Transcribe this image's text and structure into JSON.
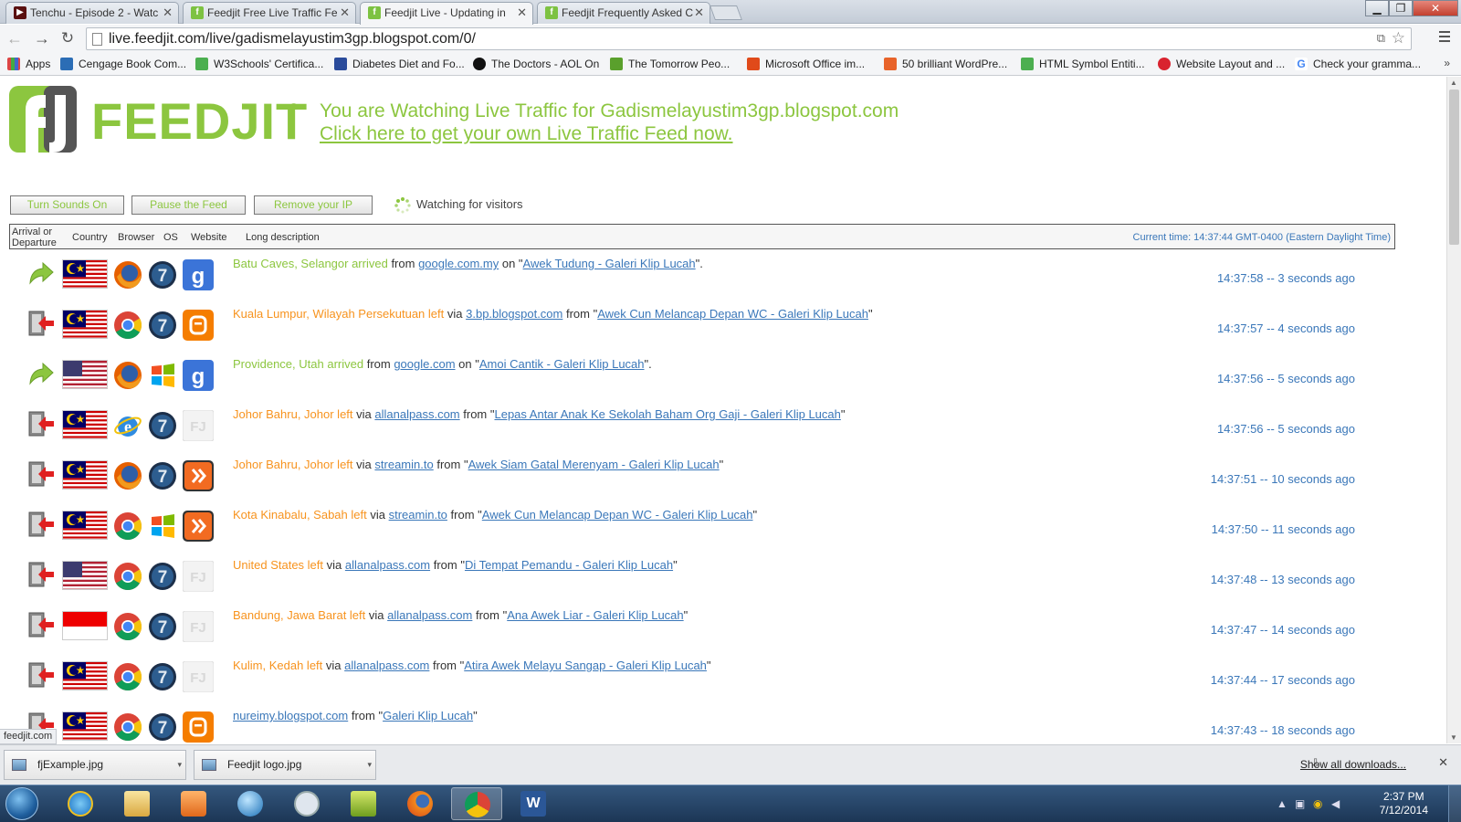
{
  "browser": {
    "tabs": [
      {
        "title": "Tenchu - Episode 2 - Watc",
        "active": false
      },
      {
        "title": "Feedjit Free Live Traffic Fe",
        "active": false
      },
      {
        "title": "Feedjit Live - Updating in",
        "active": true
      },
      {
        "title": "Feedjit Frequently Asked C",
        "active": false
      }
    ],
    "url": "live.feedjit.com/live/gadismelayustim3gp.blogspot.com/0/",
    "bookmarks": [
      "Apps",
      "Cengage Book Com...",
      "W3Schools' Certifica...",
      "Diabetes Diet and Fo...",
      "The Doctors - AOL On",
      "The Tomorrow Peo...",
      "Microsoft Office im...",
      "50 brilliant WordPre...",
      "HTML Symbol Entiti...",
      "Website Layout and ...",
      "Check your gramma..."
    ],
    "bookmarks_more": "»",
    "status_bubble": "feedjit.com"
  },
  "page": {
    "logo_text": "FEEDJIT",
    "logo_reg": "®",
    "watch_line": "You are Watching Live Traffic for Gadismelayustim3gp.blogspot.com",
    "promo_link": "Click here to get your own Live Traffic Feed now.",
    "buttons": {
      "sounds": "Turn Sounds On",
      "pause": "Pause the Feed",
      "remove_ip": "Remove your IP"
    },
    "status_text": "Watching for visitors",
    "headers": {
      "arrival_1": "Arrival or",
      "arrival_2": "Departure",
      "country": "Country",
      "browser": "Browser",
      "os": "OS",
      "website": "Website",
      "long_desc": "Long description"
    },
    "current_time": "Current time: 14:37:44 GMT-0400 (Eastern Daylight Time)",
    "colors": {
      "brand_green": "#8cc63f",
      "departure_orange": "#f7931e",
      "link_blue": "#3a77b9"
    }
  },
  "visitors": [
    {
      "direction": "arrival",
      "flag": "malaysia",
      "browser": "firefox",
      "os": "windows-7",
      "site": "google",
      "location": "Batu Caves, Selangor arrived",
      "conn": "from",
      "link": "google.com.my",
      "conn2": "on",
      "page_title": "Awek Tudung - Galeri Klip Lucah",
      "tail": "\".",
      "time": "14:37:58 -- 3 seconds ago"
    },
    {
      "direction": "departure",
      "flag": "malaysia",
      "browser": "chrome",
      "os": "windows-7",
      "site": "blogger",
      "location": "Kuala Lumpur, Wilayah Persekutuan left",
      "conn": "via",
      "link": "3.bp.blogspot.com",
      "conn2": "from",
      "page_title": "Awek Cun Melancap Depan WC - Galeri Klip Lucah",
      "tail": "\"",
      "time": "14:37:57 -- 4 seconds ago"
    },
    {
      "direction": "arrival",
      "flag": "usa",
      "browser": "firefox",
      "os": "windows-xp",
      "site": "google",
      "location": "Providence, Utah arrived",
      "conn": "from",
      "link": "google.com",
      "conn2": "on",
      "page_title": "Amoi Cantik - Galeri Klip Lucah",
      "tail": "\".",
      "time": "14:37:56 -- 5 seconds ago"
    },
    {
      "direction": "departure",
      "flag": "malaysia",
      "browser": "ie",
      "os": "windows-7",
      "site": "feedjit",
      "location": "Johor Bahru, Johor left",
      "conn": "via",
      "link": "allanalpass.com",
      "conn2": "from",
      "page_title": "Lepas Antar Anak Ke Sekolah Baham Org Gaji - Galeri Klip Lucah",
      "tail": "\"",
      "time": "14:37:56 -- 5 seconds ago"
    },
    {
      "direction": "departure",
      "flag": "malaysia",
      "browser": "firefox",
      "os": "windows-7",
      "site": "streamin",
      "location": "Johor Bahru, Johor left",
      "conn": "via",
      "link": "streamin.to",
      "conn2": "from",
      "page_title": "Awek Siam Gatal Merenyam - Galeri Klip Lucah",
      "tail": "\"",
      "time": "14:37:51 -- 10 seconds ago"
    },
    {
      "direction": "departure",
      "flag": "malaysia",
      "browser": "chrome",
      "os": "windows-xp",
      "site": "streamin",
      "location": "Kota Kinabalu, Sabah left",
      "conn": "via",
      "link": "streamin.to",
      "conn2": "from",
      "page_title": "Awek Cun Melancap Depan WC - Galeri Klip Lucah",
      "tail": "\"",
      "time": "14:37:50 -- 11 seconds ago"
    },
    {
      "direction": "departure",
      "flag": "usa",
      "browser": "chrome",
      "os": "windows-7",
      "site": "feedjit",
      "location": "United States left",
      "conn": "via",
      "link": "allanalpass.com",
      "conn2": "from",
      "page_title": "Di Tempat Pemandu - Galeri Klip Lucah",
      "tail": "\"",
      "time": "14:37:48 -- 13 seconds ago"
    },
    {
      "direction": "departure",
      "flag": "indonesia",
      "browser": "chrome",
      "os": "windows-7",
      "site": "feedjit",
      "location": "Bandung, Jawa Barat left",
      "conn": "via",
      "link": "allanalpass.com",
      "conn2": "from",
      "page_title": "Ana Awek Liar - Galeri Klip Lucah",
      "tail": "\"",
      "time": "14:37:47 -- 14 seconds ago"
    },
    {
      "direction": "departure",
      "flag": "malaysia",
      "browser": "chrome",
      "os": "windows-7",
      "site": "feedjit",
      "location": "Kulim, Kedah left",
      "conn": "via",
      "link": "allanalpass.com",
      "conn2": "from",
      "page_title": "Atira Awek Melayu Sangap - Galeri Klip Lucah",
      "tail": "\"",
      "time": "14:37:44 -- 17 seconds ago"
    },
    {
      "direction": "departure",
      "flag": "malaysia",
      "browser": "chrome",
      "os": "windows-7",
      "site": "blogger",
      "location": "",
      "conn": "",
      "link": "nureimy.blogspot.com",
      "conn2": "from",
      "page_title": "Galeri Klip Lucah",
      "tail": "\"",
      "time": "14:37:43 -- 18 seconds ago"
    }
  ],
  "downloads": {
    "items": [
      "fjExample.jpg",
      "Feedjit logo.jpg"
    ],
    "show_all": "Show all downloads..."
  },
  "taskbar": {
    "clock_time": "2:37 PM",
    "clock_date": "7/12/2014"
  }
}
